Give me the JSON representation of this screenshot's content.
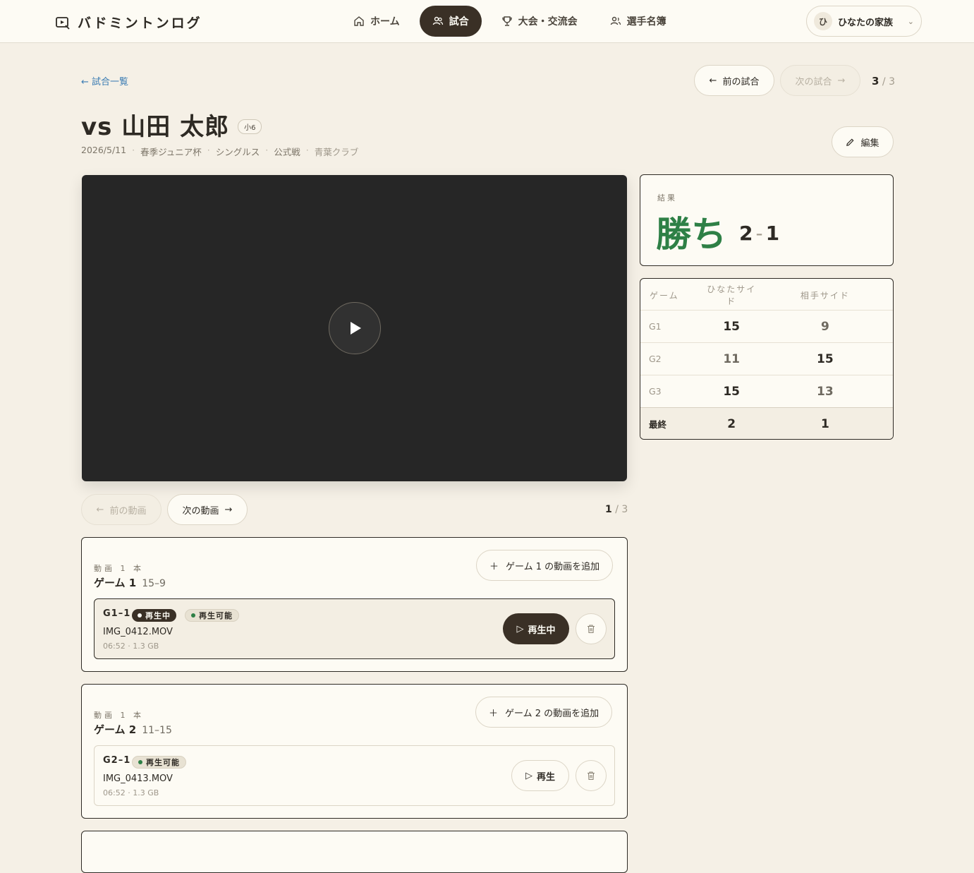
{
  "header": {
    "brand": "バドミントンログ",
    "nav": [
      {
        "label": "ホーム",
        "icon": "home-icon"
      },
      {
        "label": "試合",
        "icon": "users-icon",
        "active": true
      },
      {
        "label": "大会・交流会",
        "icon": "trophy-icon"
      },
      {
        "label": "選手名簿",
        "icon": "roster-icon"
      }
    ],
    "account": {
      "initial": "ひ",
      "name": "ひなたの家族"
    }
  },
  "breadcrumb": {
    "back": "← 試合一覧"
  },
  "match_nav": {
    "prev": "前の試合",
    "next": "次の試合",
    "current": "3",
    "sep": "/",
    "total": "3"
  },
  "match": {
    "title": "vs 山田 太郎",
    "grade": "小6",
    "edit": "編集",
    "meta": [
      "2026/5/11",
      "春季ジュニア杯",
      "シングルス",
      "公式戦",
      "青葉クラブ"
    ]
  },
  "result": {
    "label": "結果",
    "outcome": "勝ち",
    "score_for": "2",
    "score_against": "1",
    "dash": "-"
  },
  "scoreboard": {
    "headers": [
      "ゲーム",
      "ひなたサイド",
      "相手サイド"
    ],
    "rows": [
      {
        "game": "G1",
        "us": "15",
        "them": "9"
      },
      {
        "game": "G2",
        "us": "11",
        "them": "15"
      },
      {
        "game": "G3",
        "us": "15",
        "them": "13"
      }
    ],
    "final": {
      "label": "最終",
      "us": "2",
      "them": "1"
    }
  },
  "video_nav": {
    "prev": "前の動画",
    "next": "次の動画",
    "current": "1",
    "sep": "/",
    "total": "3"
  },
  "games": [
    {
      "count": "動画 1 本",
      "title": "ゲーム 1",
      "score": "15–9",
      "add": "ゲーム 1 の動画を追加",
      "clip": {
        "id": "G1–1",
        "playing_badge": "再生中",
        "ready_badge": "再生可能",
        "file": "IMG_0412.MOV",
        "duration": "06:52",
        "size": "1.3 GB",
        "button": "再生中"
      }
    },
    {
      "count": "動画 1 本",
      "title": "ゲーム 2",
      "score": "11–15",
      "add": "ゲーム 2 の動画を追加",
      "clip": {
        "id": "G2–1",
        "ready_badge": "再生可能",
        "file": "IMG_0413.MOV",
        "duration": "06:52",
        "size": "1.3 GB",
        "button": "再生"
      }
    }
  ],
  "colors": {
    "accent_dark": "#3a3026",
    "win_green": "#2e8046",
    "link_blue": "#3b7cb3",
    "background": "#f5f0e6"
  }
}
